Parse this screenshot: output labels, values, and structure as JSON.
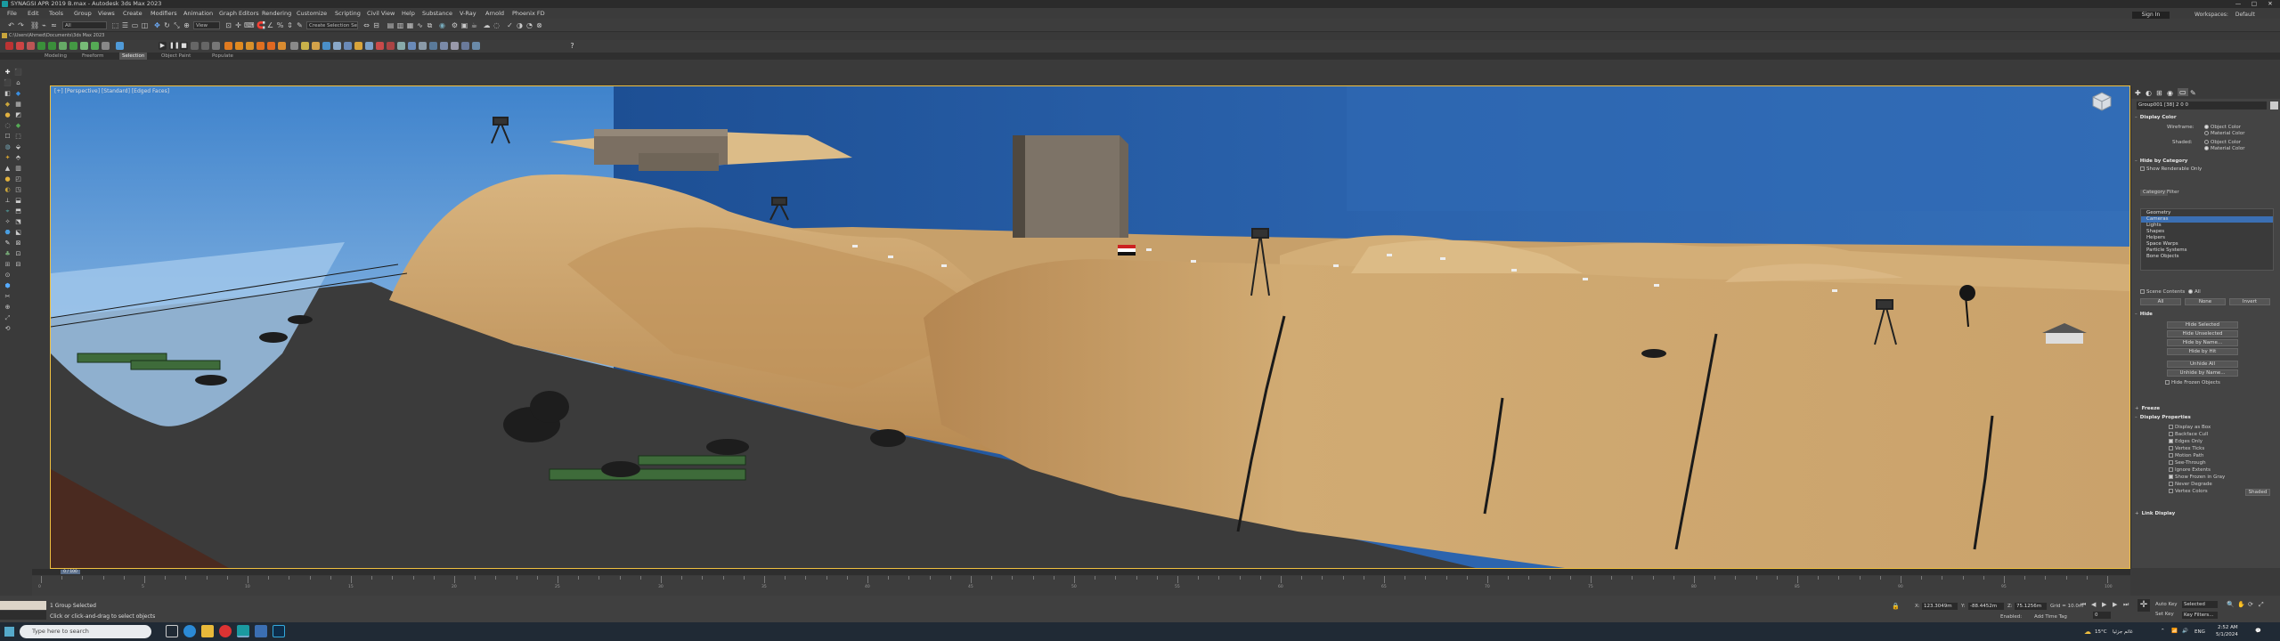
{
  "window": {
    "title": "SYNAGSI APR 2019 B.max - Autodesk 3ds Max 2023",
    "minimize": "—",
    "maximize": "□",
    "close": "✕"
  },
  "menu": [
    "File",
    "Edit",
    "Tools",
    "Group",
    "Views",
    "Create",
    "Modifiers",
    "Animation",
    "Graph Editors",
    "Rendering",
    "Customize",
    "Scripting",
    "Civil View",
    "Help",
    "Substance",
    "V-Ray",
    "Arnold",
    "Phoenix FD"
  ],
  "account": {
    "signin": "Sign In",
    "workspace_label": "Workspaces:",
    "workspace_value": "Default"
  },
  "toolbar": {
    "filter_value": "All",
    "view_value": "View",
    "selection_set": "Create Selection Se"
  },
  "project_path": "C:\\Users\\Ahmed\\Documents\\3ds Max 2023",
  "ribbon_tabs": [
    "Modeling",
    "Freeform",
    "Selection",
    "Object Paint",
    "Populate"
  ],
  "viewport": {
    "label": "[+] [Perspective] [Standard] [Edged Faces]"
  },
  "command_panel": {
    "object_name": "Group001 [38] 2 0 0",
    "display_color": {
      "title": "Display Color",
      "wireframe_label": "Wireframe:",
      "shaded_label": "Shaded:",
      "object_color": "Object Color",
      "material_color": "Material Color"
    },
    "hide_by_category": {
      "title": "Hide by Category",
      "show_renderable_only": "Show Renderable Only",
      "tabs": [
        "Category",
        "Filter"
      ],
      "items": [
        "Geometry",
        "Cameras",
        "Lights",
        "Shapes",
        "Helpers",
        "Space Warps",
        "Particle Systems",
        "Bone Objects"
      ],
      "selected_item": "Cameras",
      "scene_contents": "Scene Contents",
      "all_label": "All",
      "buttons": [
        "All",
        "None",
        "Invert"
      ]
    },
    "hide": {
      "title": "Hide",
      "buttons": [
        "Hide Selected",
        "Hide Unselected",
        "Hide by Name...",
        "Hide by Hit",
        "Unhide All",
        "Unhide by Name...",
        "Hide Frozen Objects"
      ]
    },
    "freeze": {
      "title": "Freeze"
    },
    "display_properties": {
      "title": "Display Properties",
      "items": [
        "Display as Box",
        "Backface Cull",
        "Edges Only",
        "Vertex Ticks",
        "Motion Path",
        "See-Through",
        "Ignore Extents",
        "Show Frozen in Gray",
        "Never Degrade",
        "Vertex Colors"
      ],
      "checked": [
        "Edges Only",
        "Show Frozen in Gray"
      ],
      "shaded_button": "Shaded"
    },
    "link_display": {
      "title": "Link Display"
    }
  },
  "timeline": {
    "slider_label": "0 / 100",
    "ticks": [
      0,
      5,
      10,
      15,
      20,
      25,
      30,
      35,
      40,
      45,
      50,
      55,
      60,
      65,
      70,
      75,
      80,
      85,
      90,
      95,
      100
    ]
  },
  "status": {
    "selection": "1 Group Selected",
    "prompt": "Click or click-and-drag to select objects",
    "x_label": "X:",
    "x_value": "123.3049m",
    "y_label": "Y:",
    "y_value": "-88.4452m",
    "z_label": "Z:",
    "z_value": "75.1256m",
    "grid": "Grid = 10.0m",
    "addtimetag": "Add Time Tag",
    "enabled": "Enabled:",
    "auto_key": "Auto Key",
    "set_key": "Set Key",
    "selected": "Selected",
    "key_filters": "Key Filters...",
    "frame": "0"
  },
  "taskbar": {
    "search_placeholder": "Type here to search",
    "weather": "15°C",
    "weather_desc": "غائم جزئيا",
    "lang": "ENG",
    "time": "2:52 AM",
    "date": "5/1/2024"
  },
  "colors": {
    "sky": "#3f7fc7",
    "sand": "#caa26b",
    "ground": "#3b3b3b",
    "selection": "#3b6fb3",
    "accent": "#f0c040"
  }
}
